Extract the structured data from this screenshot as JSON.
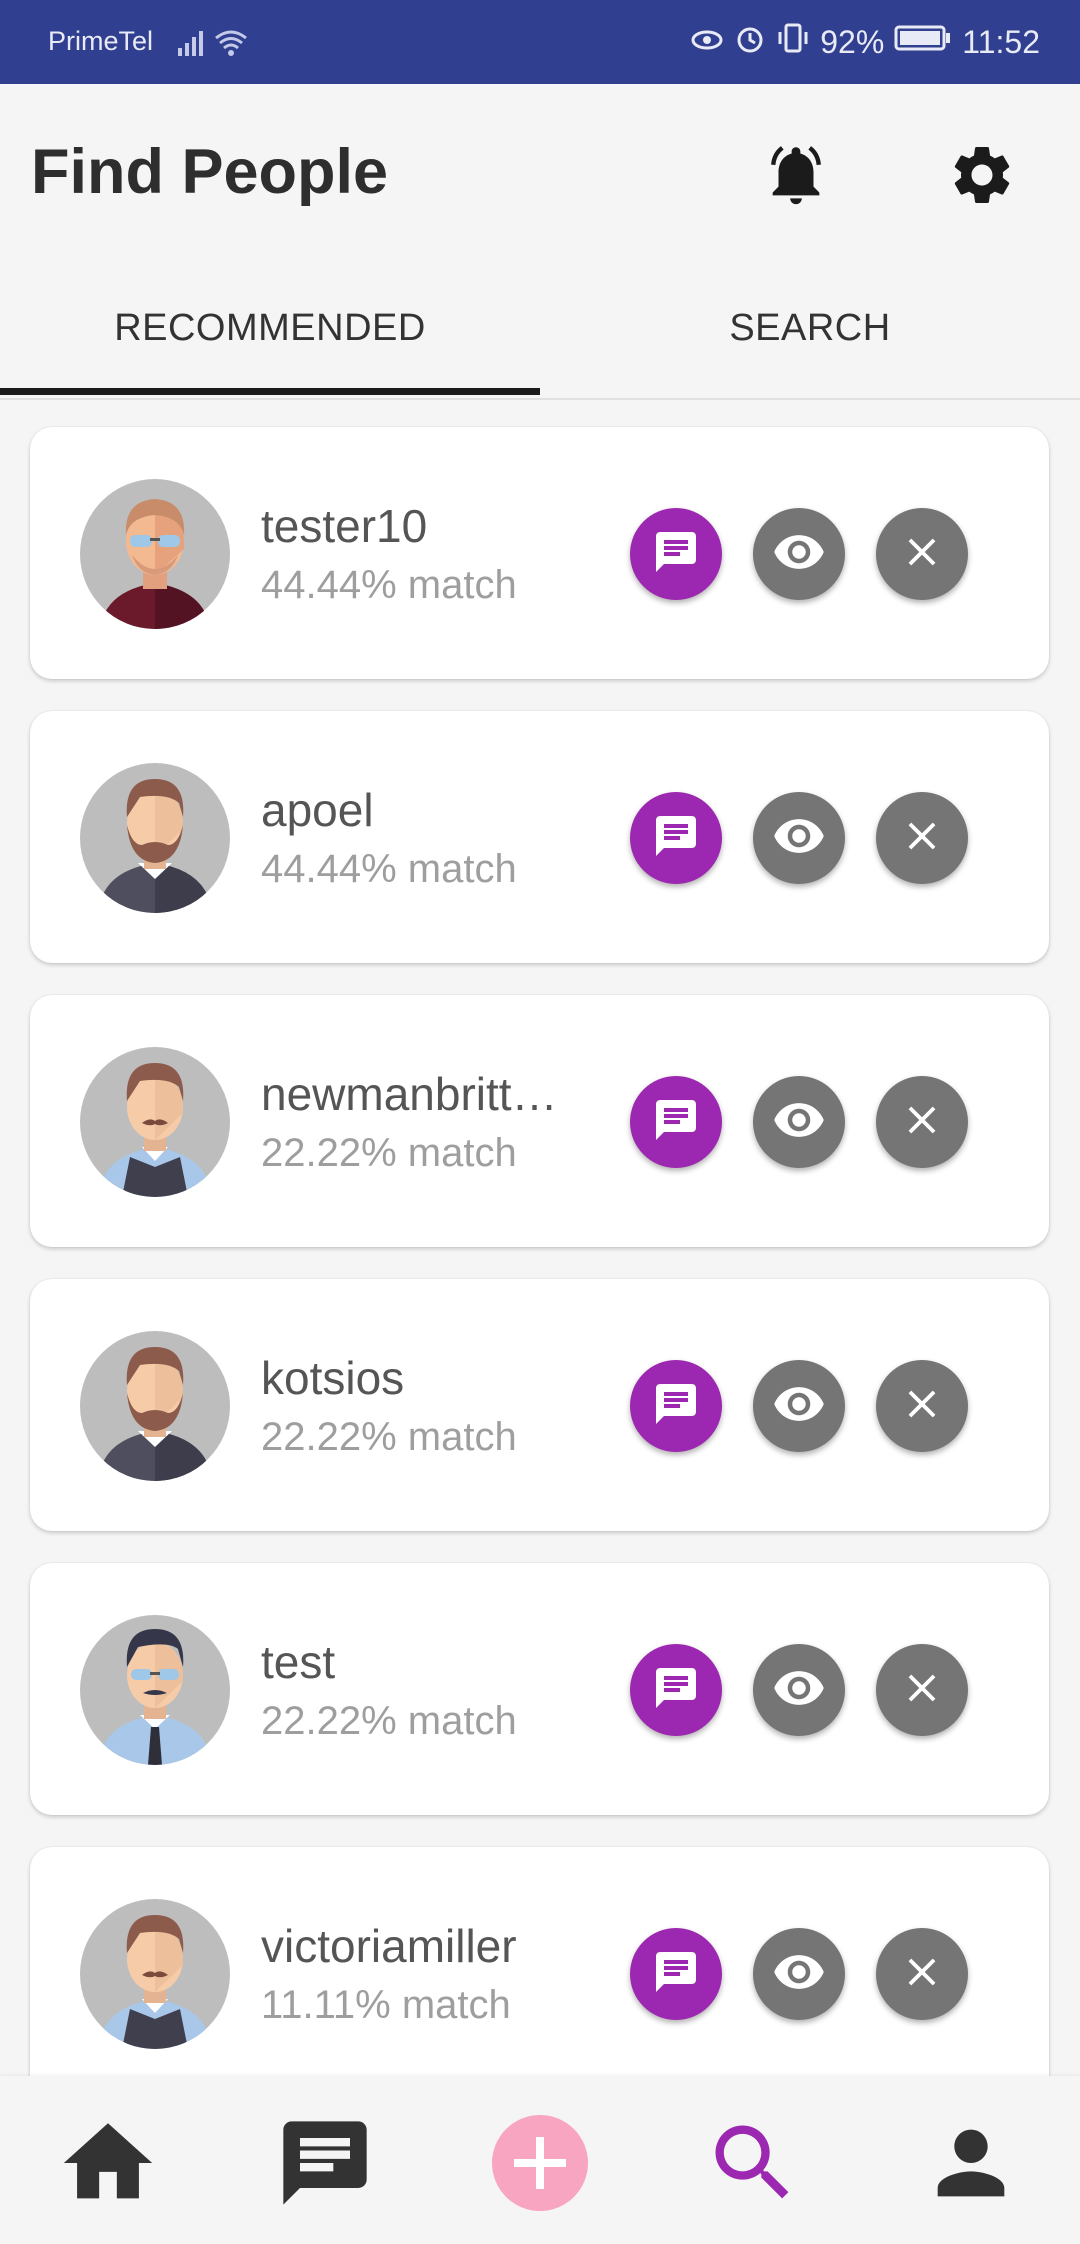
{
  "status": {
    "carrier": "PrimeTel",
    "battery": "92%",
    "time": "11:52"
  },
  "header": {
    "title": "Find People"
  },
  "tabs": [
    {
      "label": "RECOMMENDED",
      "active": true
    },
    {
      "label": "SEARCH",
      "active": false
    }
  ],
  "people": [
    {
      "name": "tester10",
      "match": "44.44% match",
      "avatar": "man-glasses-red-shirt"
    },
    {
      "name": "apoel",
      "match": "44.44% match",
      "avatar": "man-beard-dark-shirt"
    },
    {
      "name": "newmanbritt…",
      "match": "22.22% match",
      "avatar": "man-mustache-vest"
    },
    {
      "name": "kotsios",
      "match": "22.22% match",
      "avatar": "man-beard-dark-shirt"
    },
    {
      "name": "test",
      "match": "22.22% match",
      "avatar": "man-glasses-tie"
    },
    {
      "name": "victoriamiller",
      "match": "11.11% match",
      "avatar": "man-mustache-vest"
    }
  ],
  "actions": {
    "chat_icon": "chat-icon",
    "view_icon": "eye-icon",
    "dismiss_icon": "close-icon"
  },
  "colors": {
    "status_bar": "#303f8f",
    "accent": "#9c27b0",
    "add_button": "#f8a5c2",
    "action_grey": "#757575"
  },
  "bottom_nav": [
    "home-icon",
    "messages-icon",
    "add-icon",
    "search-icon",
    "profile-icon"
  ]
}
